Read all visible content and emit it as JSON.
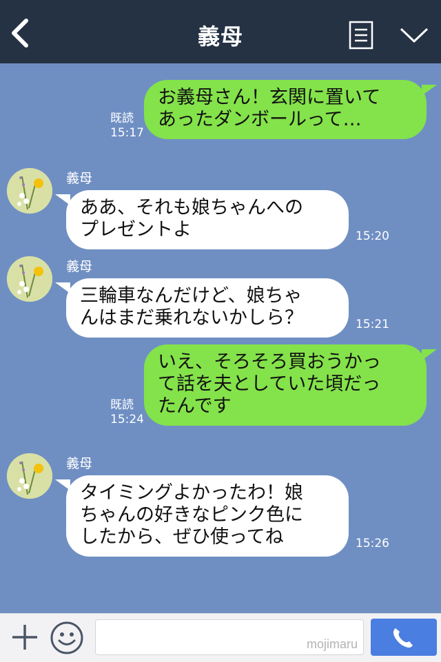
{
  "header": {
    "title": "義母",
    "icons": [
      "chevron-left-icon",
      "note-icon",
      "chevron-down-icon"
    ],
    "color": "#253244"
  },
  "chat": {
    "background": "#6f8fc3",
    "messages": [
      {
        "direction": "sent",
        "text": "お義母さん！玄関に置いて\nあったダンボールって…",
        "read": "既読",
        "time": "15:17"
      },
      {
        "direction": "received",
        "sender": "義母",
        "text": "ああ、それも娘ちゃんへの\nプレゼントよ",
        "time": "15:20"
      },
      {
        "direction": "received",
        "sender": "義母",
        "text": "三輪車なんだけど、娘ちゃ\nんはまだ乗れないかしら？",
        "time": "15:21"
      },
      {
        "direction": "sent",
        "text": "いえ、そろそろ買おうかっ\nて話を夫としていた頃だっ\nたんです",
        "read": "既読",
        "time": "15:24"
      },
      {
        "direction": "received",
        "sender": "義母",
        "text": "タイミングよかったわ！娘\nちゃんの好きなピンク色に\nしたから、ぜひ使ってね",
        "time": "15:26"
      }
    ],
    "sent_color": "#84e24a",
    "received_color": "#ffffff"
  },
  "footer": {
    "icons": [
      "plus-icon",
      "smiley-icon",
      "phone-icon"
    ],
    "input_value": "",
    "watermark": "mojimaru"
  }
}
